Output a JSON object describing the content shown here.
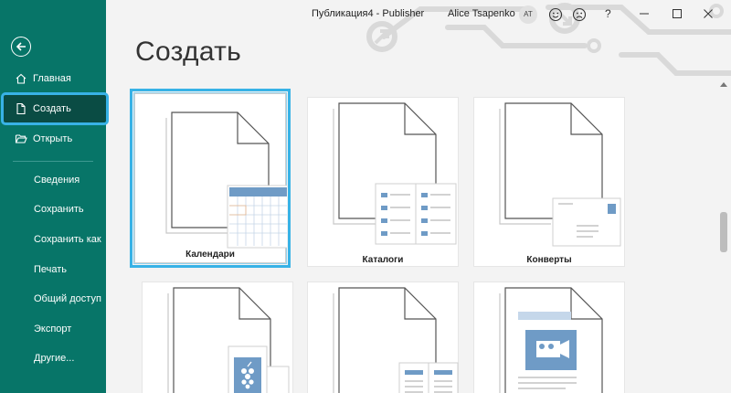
{
  "window": {
    "title": "Публикация4 - Publisher",
    "user_name": "Alice Tsapenko",
    "avatar_initials": "AT",
    "help_label": "?"
  },
  "sidebar": {
    "items": [
      {
        "label": "Главная",
        "icon": "home-icon"
      },
      {
        "label": "Создать",
        "icon": "new-document-icon",
        "active": true
      },
      {
        "label": "Открыть",
        "icon": "open-folder-icon"
      },
      {
        "label": "Сведения"
      },
      {
        "label": "Сохранить"
      },
      {
        "label": "Сохранить как"
      },
      {
        "label": "Печать"
      },
      {
        "label": "Общий доступ"
      },
      {
        "label": "Экспорт"
      },
      {
        "label": "Другие..."
      }
    ]
  },
  "main": {
    "title": "Создать",
    "templates": [
      {
        "label": "Календари",
        "selected": true
      },
      {
        "label": "Каталоги"
      },
      {
        "label": "Конверты"
      },
      {
        "label": ""
      },
      {
        "label": ""
      },
      {
        "label": ""
      }
    ]
  },
  "colors": {
    "sidebar": "#077568",
    "sidebar_active": "#0a4c44",
    "highlight": "#38b2e6",
    "thumbnail_accent": "#6f9bc6"
  }
}
